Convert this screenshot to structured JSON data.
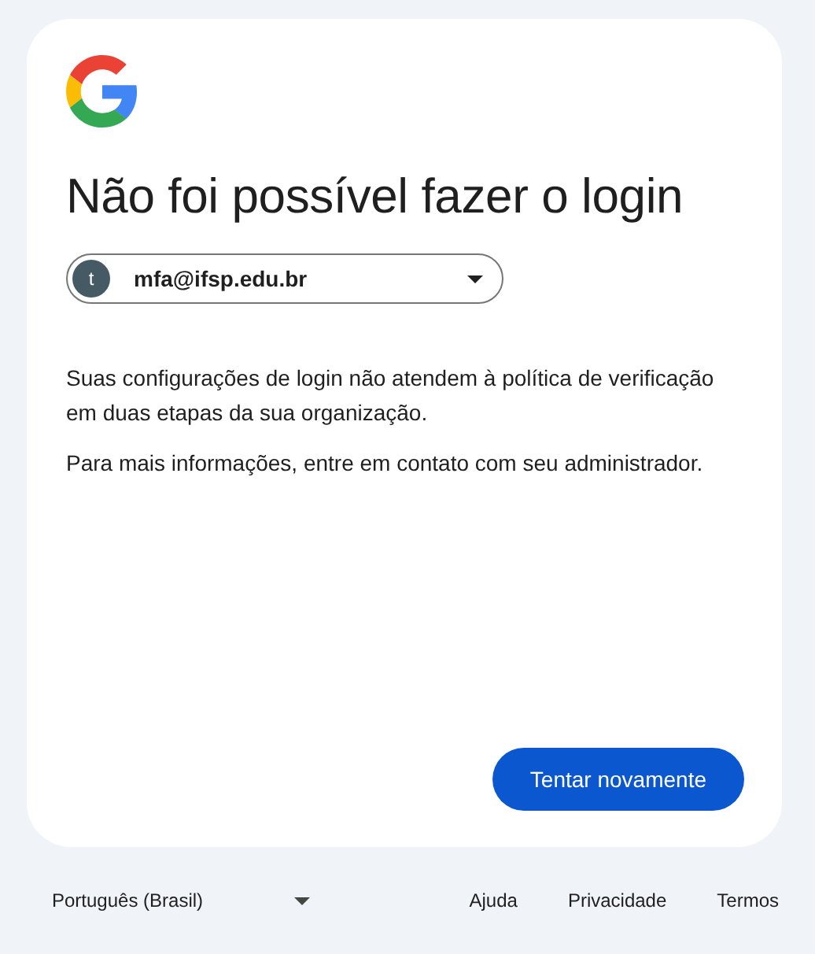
{
  "title": "Não foi possível fazer o login",
  "account": {
    "avatar_letter": "t",
    "email": "mfa@ifsp.edu.br"
  },
  "paragraphs": [
    "Suas configurações de login não atendem à política de verificação em duas etapas da sua organização.",
    "Para mais informações, entre em contato com seu administrador."
  ],
  "primary_button": "Tentar novamente",
  "footer": {
    "language": "Português (Brasil)",
    "links": [
      "Ajuda",
      "Privacidade",
      "Termos"
    ]
  }
}
